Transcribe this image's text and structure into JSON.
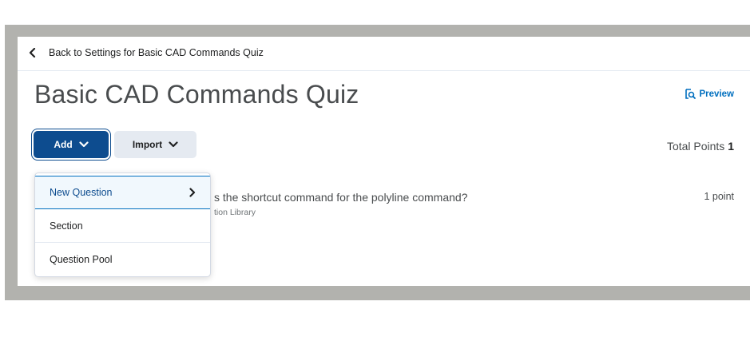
{
  "nav": {
    "back_label": "Back to Settings for Basic CAD Commands Quiz"
  },
  "header": {
    "title": "Basic CAD Commands Quiz",
    "preview_label": "Preview"
  },
  "toolbar": {
    "add_label": "Add",
    "import_label": "Import"
  },
  "summary": {
    "total_points_label": "Total Points",
    "total_points_value": "1"
  },
  "question": {
    "text": "s the shortcut command for the polyline command?",
    "source": "tion Library",
    "points": "1 point"
  },
  "add_menu": {
    "items": [
      {
        "label": "New Question",
        "has_submenu": true
      },
      {
        "label": "Section"
      },
      {
        "label": "Question Pool"
      }
    ]
  },
  "icons": {
    "back": "chevron-left-icon",
    "preview": "preview-icon",
    "dropdown": "chevron-down-icon",
    "submenu": "chevron-right-icon"
  },
  "colors": {
    "primary": "#0d4c8f",
    "link": "#006fbf",
    "frame": "#b2b2ae",
    "secondary_button": "#e5eaf1"
  }
}
